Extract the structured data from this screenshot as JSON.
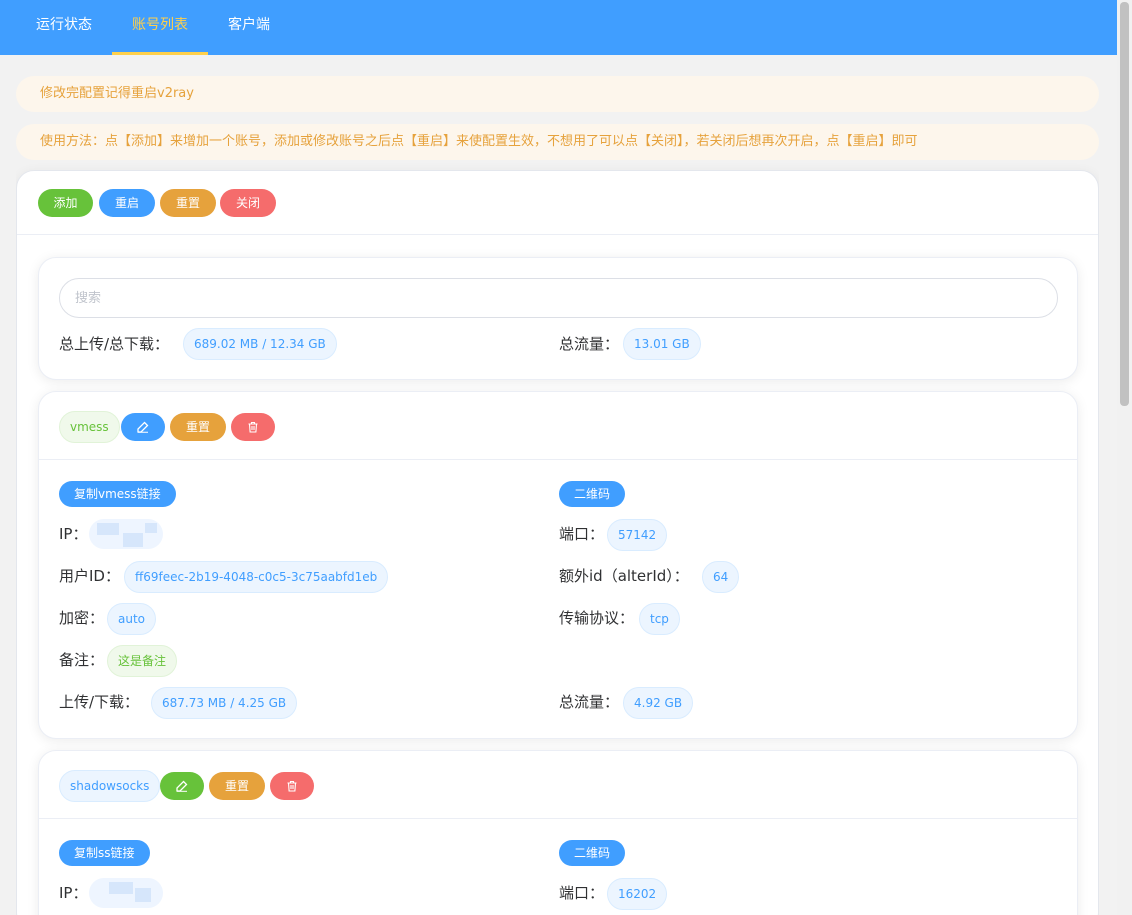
{
  "nav": {
    "tabs": [
      {
        "label": "运行状态"
      },
      {
        "label": "账号列表"
      },
      {
        "label": "客户端"
      }
    ]
  },
  "alerts": {
    "restart_notice": "修改完配置记得重启v2ray",
    "usage_notice": "使用方法：点【添加】来增加一个账号，添加或修改账号之后点【重启】来使配置生效，不想用了可以点【关闭】，若关闭后想再次开启，点【重启】即可"
  },
  "toolbar": {
    "add": "添加",
    "restart": "重启",
    "reset": "重置",
    "close": "关闭"
  },
  "summary": {
    "search_placeholder": "搜索",
    "total_updown_label": "总上传/总下载：",
    "total_updown_value": "689.02 MB / 12.34 GB",
    "total_traffic_label": "总流量：",
    "total_traffic_value": "13.01 GB"
  },
  "accounts": [
    {
      "protocol": "vmess",
      "reset_label": "重置",
      "copy_link_label": "复制vmess链接",
      "qrcode_label": "二维码",
      "ip_label": "IP：",
      "port_label": "端口：",
      "port_value": "57142",
      "userid_label": "用户ID：",
      "userid_value": "ff69feec-2b19-4048-c0c5-3c75aabfd1eb",
      "alterid_label": "额外id（alterId）：",
      "alterid_value": "64",
      "security_label": "加密：",
      "security_value": "auto",
      "network_label": "传输协议：",
      "network_value": "tcp",
      "remark_label": "备注：",
      "remark_value": "这是备注",
      "updown_label": "上传/下载：",
      "updown_value": "687.73 MB / 4.25 GB",
      "traffic_label": "总流量：",
      "traffic_value": "4.92 GB"
    },
    {
      "protocol": "shadowsocks",
      "reset_label": "重置",
      "copy_link_label": "复制ss链接",
      "qrcode_label": "二维码",
      "ip_label": "IP：",
      "port_label": "端口：",
      "port_value": "16202"
    }
  ],
  "colors": {
    "primary": "#409eff",
    "success": "#67c23a",
    "warning": "#e6a23c",
    "danger": "#f56c6c",
    "active_tab": "#ffd04b"
  }
}
